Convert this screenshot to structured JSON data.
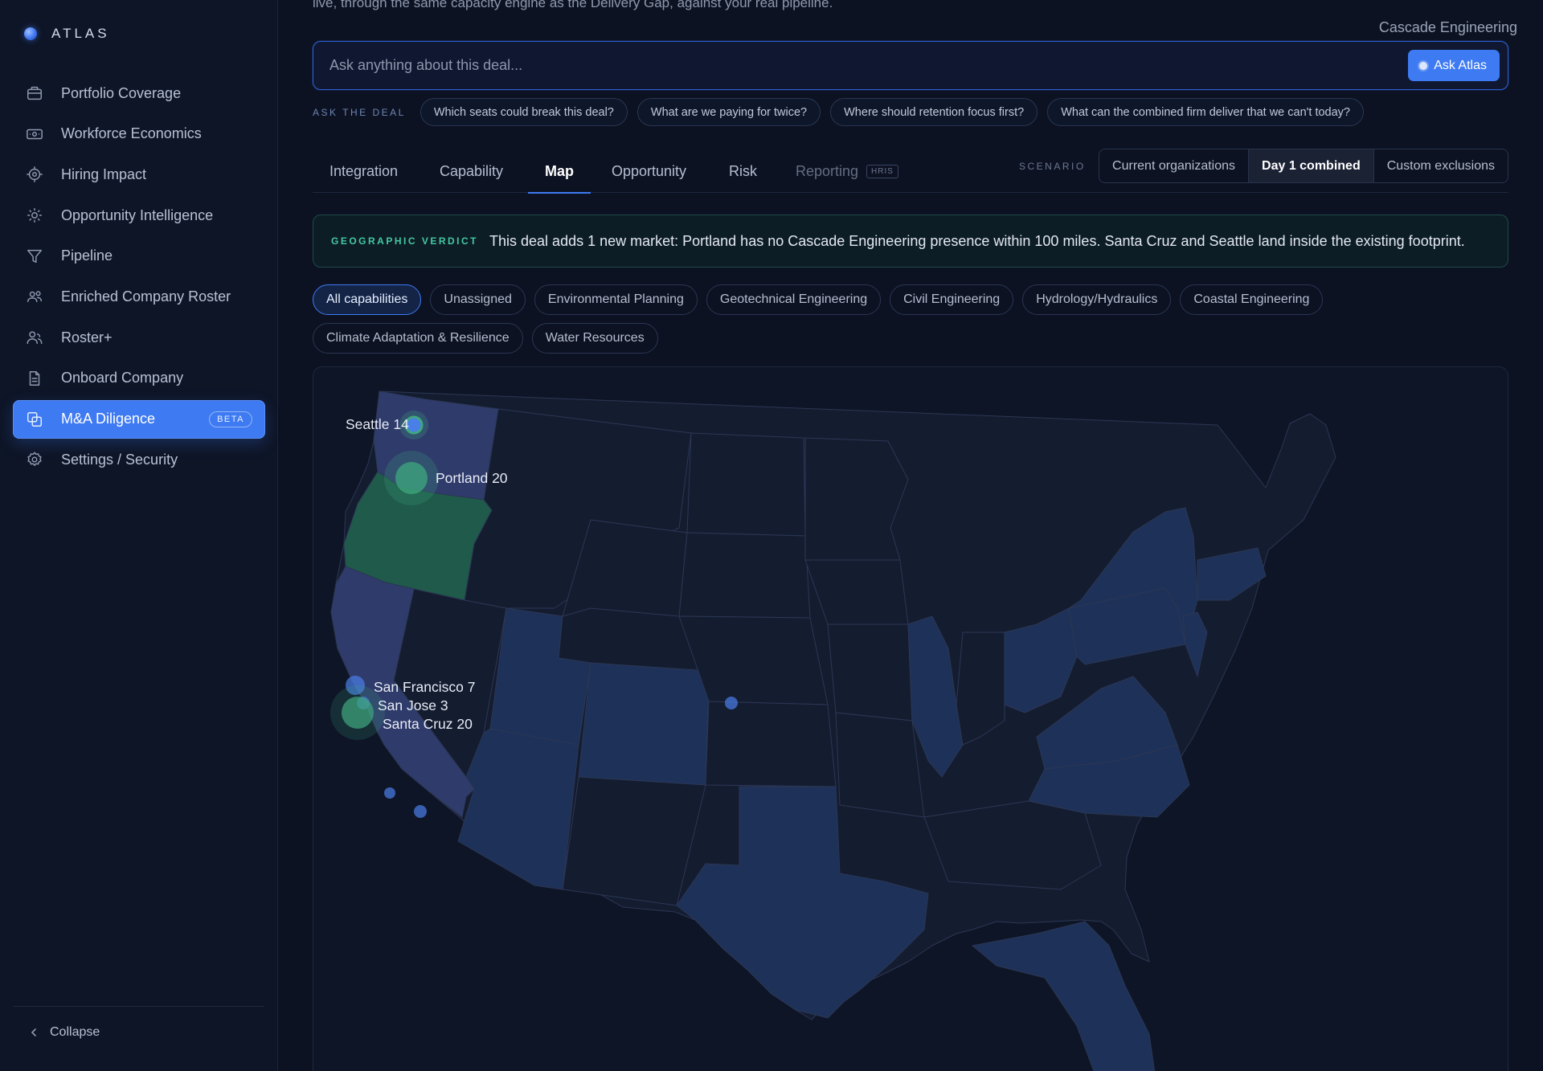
{
  "brand": {
    "name": "ATLAS"
  },
  "sidebar": {
    "items": [
      {
        "label": "Portfolio Coverage",
        "icon": "briefcase-icon"
      },
      {
        "label": "Workforce Economics",
        "icon": "cash-icon"
      },
      {
        "label": "Hiring Impact",
        "icon": "target-icon"
      },
      {
        "label": "Opportunity Intelligence",
        "icon": "sun-icon"
      },
      {
        "label": "Pipeline",
        "icon": "filter-icon"
      },
      {
        "label": "Enriched Company Roster",
        "icon": "users-icon"
      },
      {
        "label": "Roster+",
        "icon": "user-plus-icon"
      },
      {
        "label": "Onboard Company",
        "icon": "document-icon"
      },
      {
        "label": "M&A Diligence",
        "icon": "merge-icon",
        "badge": "BETA",
        "active": true
      },
      {
        "label": "Settings / Security",
        "icon": "gear-icon"
      }
    ],
    "collapse_label": "Collapse"
  },
  "header": {
    "intro_cut": "live, through the same capacity engine as the Delivery Gap, against your real pipeline.",
    "company": "Cascade Engineering"
  },
  "ask": {
    "placeholder": "Ask anything about this deal...",
    "button_label": "Ask Atlas",
    "section_label": "ASK THE DEAL",
    "chips": [
      "Which seats could break this deal?",
      "What are we paying for twice?",
      "Where should retention focus first?",
      "What can the combined firm deliver that we can't today?"
    ]
  },
  "tabs": [
    {
      "label": "Integration"
    },
    {
      "label": "Capability"
    },
    {
      "label": "Map",
      "active": true
    },
    {
      "label": "Opportunity"
    },
    {
      "label": "Risk"
    },
    {
      "label": "Reporting",
      "badge": "HRIS",
      "disabled": true
    }
  ],
  "scenario": {
    "label": "SCENARIO",
    "options": [
      "Current organizations",
      "Day 1 combined",
      "Custom exclusions"
    ],
    "selected": "Day 1 combined"
  },
  "verdict": {
    "label": "GEOGRAPHIC VERDICT",
    "text": "This deal adds 1 new market: Portland has no Cascade Engineering presence within 100 miles. Santa Cruz and Seattle land inside the existing footprint."
  },
  "filters": {
    "row1": [
      "All capabilities",
      "Unassigned",
      "Environmental Planning",
      "Geotechnical Engineering",
      "Civil Engineering",
      "Hydrology/Hydraulics",
      "Coastal Engineering"
    ],
    "row2": [
      "Climate Adaptation & Resilience",
      "Water Resources"
    ],
    "selected": "All capabilities"
  },
  "map": {
    "labels": [
      {
        "city": "Seattle",
        "count": "14"
      },
      {
        "city": "Portland",
        "count": "20"
      },
      {
        "city": "San Francisco",
        "count": "7"
      },
      {
        "city": "San Jose",
        "count": "3"
      },
      {
        "city": "Santa Cruz",
        "count": "20"
      }
    ],
    "colors": {
      "new_market": "#1f5a4a",
      "acquirer_state": "#1e3158",
      "combined_state": "#2f3b6b",
      "base_state": "#141c30",
      "marker_blue": "#4a7fe8",
      "marker_green": "#3fa77e"
    }
  }
}
